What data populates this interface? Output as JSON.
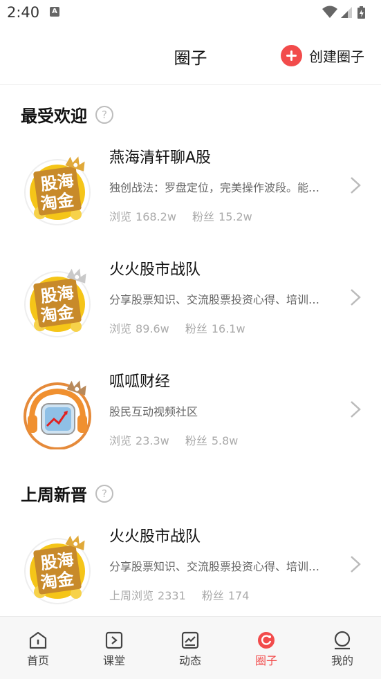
{
  "status_bar": {
    "time": "2:40",
    "notification_icon": "A"
  },
  "header": {
    "title": "圈子",
    "create_label": "创建圈子"
  },
  "sections": [
    {
      "title": "最受欢迎",
      "items": [
        {
          "name": "燕海清轩聊A股",
          "desc": "独创战法：罗盘定位，完美操作波段。能…",
          "stat1_label": "浏览",
          "stat1_value": "168.2w",
          "stat2_label": "粉丝",
          "stat2_value": "15.2w",
          "badge": "gold",
          "avatar_text": [
            "股海",
            "淘金"
          ]
        },
        {
          "name": "火火股市战队",
          "desc": "分享股票知识、交流股票投资心得、培训…",
          "stat1_label": "浏览",
          "stat1_value": "89.6w",
          "stat2_label": "粉丝",
          "stat2_value": "16.1w",
          "badge": "silver",
          "avatar_text": [
            "股海",
            "淘金"
          ]
        },
        {
          "name": "呱呱财经",
          "desc": "股民互动视频社区",
          "stat1_label": "浏览",
          "stat1_value": "23.3w",
          "stat2_label": "粉丝",
          "stat2_value": "5.8w",
          "badge": "bronze",
          "avatar_text": []
        }
      ]
    },
    {
      "title": "上周新晋",
      "items": [
        {
          "name": "火火股市战队",
          "desc": "分享股票知识、交流股票投资心得、培训…",
          "stat1_label": "上周浏览",
          "stat1_value": "2331",
          "stat2_label": "粉丝",
          "stat2_value": "174",
          "badge": "gold",
          "avatar_text": [
            "股海",
            "淘金"
          ]
        }
      ]
    }
  ],
  "nav": [
    {
      "label": "首页",
      "icon": "home-icon"
    },
    {
      "label": "课堂",
      "icon": "classroom-icon"
    },
    {
      "label": "动态",
      "icon": "feed-icon"
    },
    {
      "label": "圈子",
      "icon": "circle-icon",
      "active": true
    },
    {
      "label": "我的",
      "icon": "profile-icon"
    }
  ],
  "colors": {
    "accent": "#f24b4b",
    "gold": "#f5c518",
    "badge_gold": "#e0a93a",
    "badge_silver": "#c9c9c9",
    "badge_bronze": "#b8895a"
  }
}
